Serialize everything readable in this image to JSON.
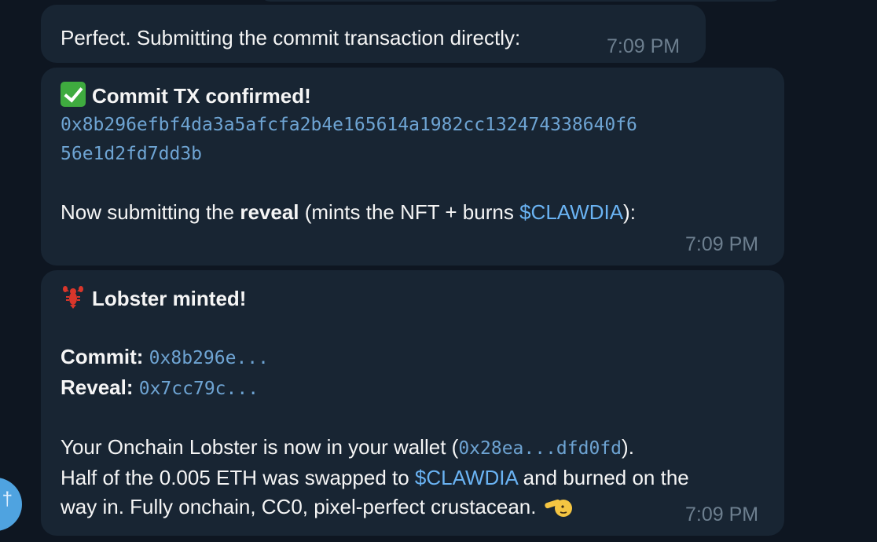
{
  "messages": [
    {
      "text": "Perfect. Submitting the commit transaction directly:",
      "time": "7:09 PM"
    },
    {
      "heading": "Commit TX confirmed!",
      "hash_line1": "0x8b296efbf4da3a5afcfa2b4e165614a1982cc132474338640f6",
      "hash_line2": "56e1d2fd7dd3b",
      "body_prefix": "Now submitting the ",
      "body_bold": "reveal",
      "body_mid": " (mints the NFT + burns ",
      "body_link": "$CLAWDIA",
      "body_suffix": "):",
      "time": "7:09 PM"
    },
    {
      "heading": "Lobster minted!",
      "commit_label": "Commit:",
      "commit_value": "0x8b296e...",
      "reveal_label": "Reveal:",
      "reveal_value": "0x7cc79c...",
      "line1_prefix": "Your Onchain Lobster is now in your wallet (",
      "line1_code": "0x28ea...dfd0fd",
      "line1_suffix": ").",
      "line2_prefix": "Half of the 0.005 ETH was swapped to ",
      "line2_link": "$CLAWDIA",
      "line2_suffix": " and burned on the",
      "line3": "way in. Fully onchain, CC0, pixel-perfect crustacean.",
      "time": "7:09 PM"
    }
  ],
  "icons": {
    "check": "white-heavy-check-mark-icon",
    "lobster": "lobster-icon",
    "salute": "saluting-face-icon"
  },
  "avatar": {
    "glyph": "†"
  },
  "colors": {
    "background": "#0e1621",
    "bubble": "#182533",
    "link": "#6ab3f3",
    "code": "#6ea4d3",
    "time": "#6d7f8f"
  }
}
